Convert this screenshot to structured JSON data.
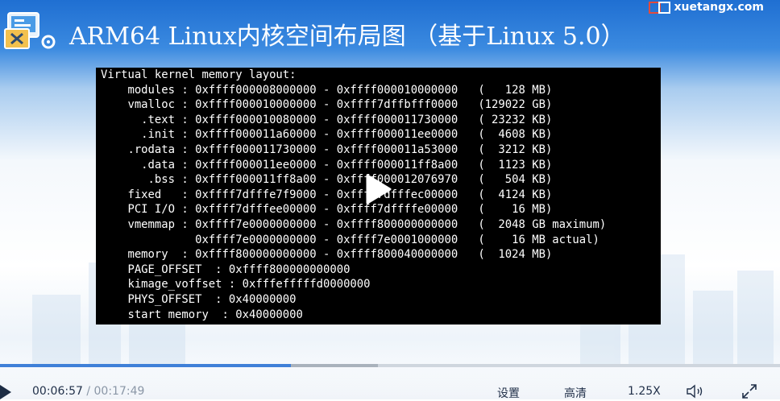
{
  "slide": {
    "title": "ARM64 Linux内核空间布局图 （基于Linux 5.0）",
    "brand": "xuetangx.com"
  },
  "terminal": {
    "lines": [
      "Virtual kernel memory layout:",
      "    modules : 0xffff000008000000 - 0xffff000010000000   (   128 MB)",
      "    vmalloc : 0xffff000010000000 - 0xffff7dffbfff0000   (129022 GB)",
      "      .text : 0xffff000010080000 - 0xffff000011730000   ( 23232 KB)",
      "      .init : 0xffff000011a60000 - 0xffff000011ee0000   (  4608 KB)",
      "    .rodata : 0xffff000011730000 - 0xffff000011a53000   (  3212 KB)",
      "      .data : 0xffff000011ee0000 - 0xffff000011ff8a00   (  1123 KB)",
      "       .bss : 0xffff000011ff8a00 - 0xffff000012076970   (   504 KB)",
      "    fixed   : 0xffff7dfffe7f9000 - 0xffff7dfffec00000   (  4124 KB)",
      "    PCI I/O : 0xffff7dfffee00000 - 0xffff7dffffe00000   (    16 MB)",
      "    vmemmap : 0xffff7e0000000000 - 0xffff800000000000   (  2048 GB maximum)",
      "              0xffff7e0000000000 - 0xffff7e0001000000   (    16 MB actual)",
      "    memory  : 0xffff800000000000 - 0xffff800040000000   (  1024 MB)",
      "    PAGE_OFFSET  : 0xffff800000000000",
      "    kimage_voffset : 0xfffefffffd0000000",
      "    PHYS_OFFSET  : 0x40000000",
      "    start memory  : 0x40000000"
    ]
  },
  "player": {
    "current_time": "00:06:57",
    "separator": " / ",
    "total_time": "00:17:49",
    "progress_fraction": 0.373,
    "buffered_fraction": 0.484,
    "settings_label": "设置",
    "quality_label": "高清",
    "speed_label": "1.25X",
    "accent_color": "#3f80d8"
  },
  "icons": [
    "play-icon",
    "volume-icon",
    "fullscreen-icon",
    "brand-logo-icon",
    "app-icon"
  ]
}
